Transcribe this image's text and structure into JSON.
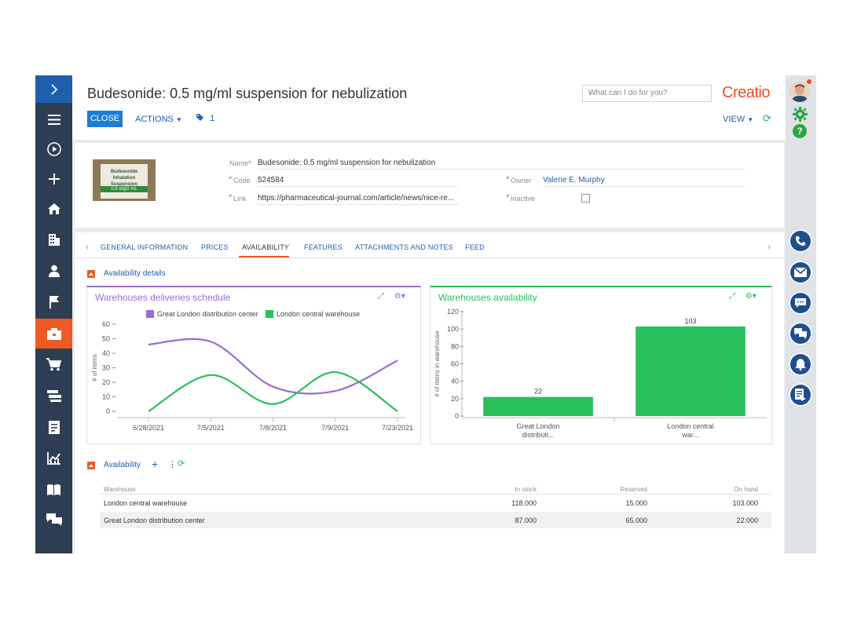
{
  "header": {
    "title": "Budesonide: 0.5 mg/ml suspension for nebulization",
    "search_placeholder": "What can I do for you?",
    "logo": "Creatio",
    "close_label": "CLOSE",
    "actions_label": "ACTIONS",
    "tag_count": "1",
    "view_label": "VIEW"
  },
  "product_image": {
    "package_text": "Budesonide Inhalation Suspension",
    "package_dose": "0.5 mg/2 mL"
  },
  "fields": {
    "name_label": "Name",
    "name_value": "Budesonide: 0.5 mg/ml suspension for nebulization",
    "code_label": "Code",
    "code_value": "524584",
    "link_label": "Link",
    "link_value": "https://pharmaceutical-journal.com/article/news/nice-re...",
    "owner_label": "Owner",
    "owner_value": "Valerie E. Murphy",
    "inactive_label": "Inactive",
    "inactive_checked": false
  },
  "tabs": [
    {
      "label": "GENERAL INFORMATION",
      "active": false
    },
    {
      "label": "PRICES",
      "active": false
    },
    {
      "label": "AVAILABILITY",
      "active": true
    },
    {
      "label": "FEATURES",
      "active": false
    },
    {
      "label": "ATTACHMENTS AND NOTES",
      "active": false
    },
    {
      "label": "FEED",
      "active": false
    }
  ],
  "availability_details": {
    "section_title": "Availability details"
  },
  "chart_data": [
    {
      "type": "line",
      "title": "Warehouses deliveries schedule",
      "ylabel": "# of items",
      "xlabel": "",
      "ylim": [
        0,
        60
      ],
      "yticks": [
        0,
        10,
        20,
        30,
        40,
        50,
        60
      ],
      "categories": [
        "6/28/2021",
        "7/5/2021",
        "7/8/2021",
        "7/9/2021",
        "7/23/2021"
      ],
      "legend_position": "top",
      "series": [
        {
          "name": "Great London distribution center",
          "color": "#9b6dcf",
          "values": [
            46,
            48,
            17,
            14,
            35
          ]
        },
        {
          "name": "London central warehouse",
          "color": "#28c05a",
          "values": [
            0,
            25,
            5,
            27,
            0
          ]
        }
      ]
    },
    {
      "type": "bar",
      "title": "Warehouses availability",
      "ylabel": "# of items in warehouse",
      "xlabel": "",
      "ylim": [
        0,
        120
      ],
      "yticks": [
        0,
        20,
        40,
        60,
        80,
        100,
        120
      ],
      "categories": [
        "Great London distributi...",
        "London central war..."
      ],
      "values": [
        22,
        103
      ],
      "color": "#28c05a"
    }
  ],
  "availability": {
    "section_title": "Availability",
    "columns": [
      "Warehouse",
      "In stock",
      "Reserved",
      "On hand"
    ],
    "rows": [
      {
        "warehouse": "London central warehouse",
        "in_stock": "118.000",
        "reserved": "15.000",
        "on_hand": "103.000"
      },
      {
        "warehouse": "Great London distribution center",
        "in_stock": "87.000",
        "reserved": "65.000",
        "on_hand": "22.000"
      }
    ]
  },
  "colors": {
    "accent": "#1a7dd7",
    "brand": "#f04b23",
    "sidebar": "#2e3e52",
    "active_section": "#ee5a24",
    "line_purple": "#9b6dcf",
    "green": "#28c05a"
  },
  "sidebar_icons": [
    "chevron-right-icon",
    "menu-icon",
    "play-icon",
    "plus-icon",
    "home-icon",
    "building-icon",
    "contact-icon",
    "flag-icon",
    "products-icon",
    "cart-icon",
    "documents-icon",
    "invoice-icon",
    "analytics-icon",
    "book-icon",
    "chat-icon"
  ]
}
